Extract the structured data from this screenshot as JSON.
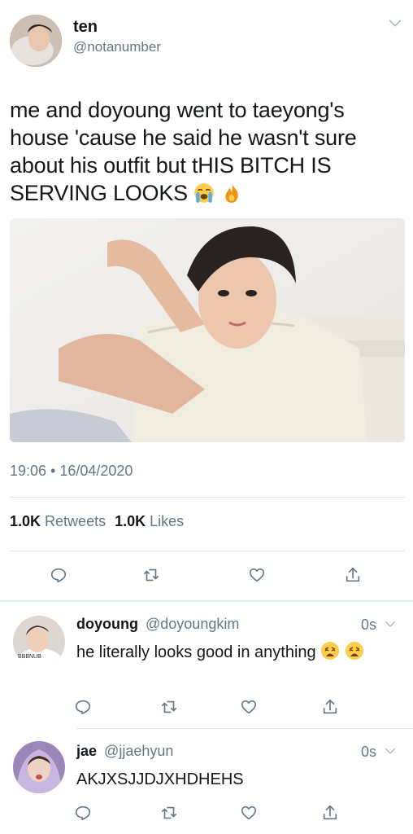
{
  "tweet": {
    "author_name": "ten",
    "author_handle": "@notanumber",
    "text": "me and doyoung went to taeyong's house 'cause he said he wasn't sure about his outfit but tHIS BITCH IS SERVING LOOKS",
    "emojis": [
      "loudly-crying-face",
      "fire"
    ],
    "timestamp": "19:06 • 16/04/2020",
    "retweets_count": "1.0K",
    "retweets_label": "Retweets",
    "likes_count": "1.0K",
    "likes_label": "Likes"
  },
  "replies": [
    {
      "name": "doyoung",
      "handle": "@doyoungkim",
      "time": "0s",
      "text": "he literally looks good in anything",
      "emojis": [
        "weary-face",
        "weary-face"
      ],
      "avatar_caption": "BBBNUB"
    },
    {
      "name": "jae",
      "handle": "@jjaehyun",
      "time": "0s",
      "text": "AKJXSJJDJXHDHEHS",
      "emojis": []
    }
  ],
  "icons": {
    "reply": "reply-icon",
    "retweet": "retweet-icon",
    "like": "heart-icon",
    "share": "share-icon",
    "more": "chevron-down-icon"
  },
  "colors": {
    "text": "#14171a",
    "muted": "#657786",
    "divider": "#e1e8ed"
  }
}
